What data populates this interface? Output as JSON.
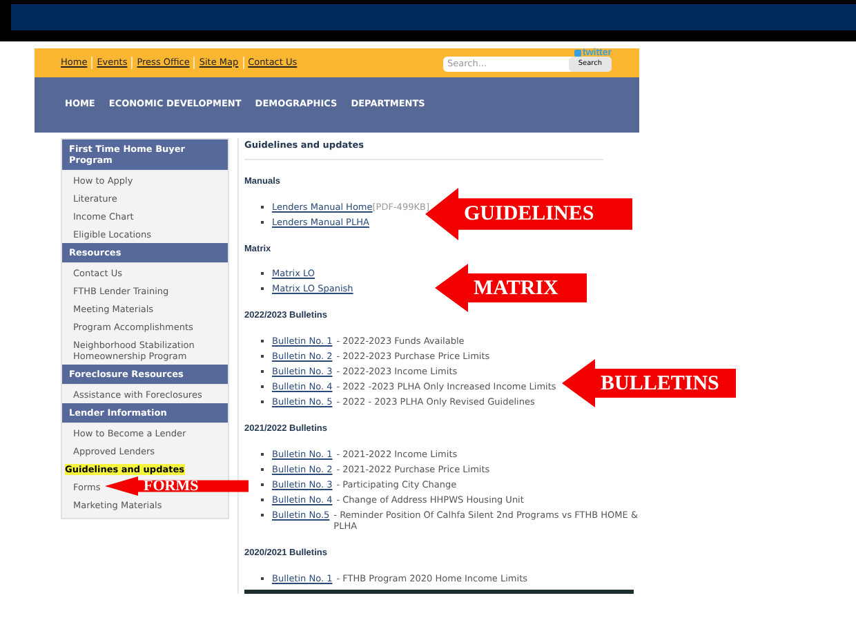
{
  "header": {
    "top_links": [
      "Home",
      "Events",
      "Press Office",
      "Site Map",
      "Contact Us"
    ],
    "twitter": "twitter",
    "search": {
      "placeholder": "Search...",
      "button": "Search"
    }
  },
  "nav": [
    "HOME",
    "ECONOMIC DEVELOPMENT",
    "DEMOGRAPHICS",
    "DEPARTMENTS"
  ],
  "sidebar": [
    {
      "title": "First Time Home Buyer Program",
      "items": [
        {
          "label": "How to Apply",
          "selected": false
        },
        {
          "label": "Literature",
          "selected": false
        },
        {
          "label": "Income Chart",
          "selected": false
        },
        {
          "label": "Eligible Locations",
          "selected": false
        }
      ]
    },
    {
      "title": "Resources",
      "items": [
        {
          "label": "Contact Us",
          "selected": false
        },
        {
          "label": "FTHB Lender Training",
          "selected": false
        },
        {
          "label": "Meeting Materials",
          "selected": false
        },
        {
          "label": "Program Accomplishments",
          "selected": false
        },
        {
          "label": "Neighborhood Stabilization Homeownership Program",
          "selected": false
        }
      ]
    },
    {
      "title": "Foreclosure Resources",
      "items": [
        {
          "label": "Assistance with Foreclosures",
          "selected": false
        }
      ]
    },
    {
      "title": "Lender Information",
      "items": [
        {
          "label": "How to Become a Lender",
          "selected": false
        },
        {
          "label": "Approved Lenders",
          "selected": false
        },
        {
          "label": "Guidelines and updates",
          "selected": true
        },
        {
          "label": "Forms",
          "selected": false
        },
        {
          "label": "Marketing Materials",
          "selected": false
        }
      ]
    }
  ],
  "content": {
    "title": "Guidelines and updates",
    "sections": [
      {
        "heading": "Manuals",
        "items": [
          {
            "link": "Lenders Manual Home",
            "note": "[PDF-499KB]"
          },
          {
            "link": "Lenders Manual PLHA"
          }
        ]
      },
      {
        "heading": "Matrix",
        "items": [
          {
            "link": "Matrix LO"
          },
          {
            "link": "Matrix LO Spanish"
          }
        ]
      },
      {
        "heading": "2022/2023 Bulletins",
        "items": [
          {
            "link": "Bulletin No. 1",
            "text": "-  2022-2023 Funds Available"
          },
          {
            "link": "Bulletin No. 2",
            "text": "-  2022-2023 Purchase Price Limits"
          },
          {
            "link": "Bulletin No. 3",
            "text": "- 2022-2023 Income Limits"
          },
          {
            "link": "Bulletin No. 4",
            "text": "- 2022 -2023 PLHA Only Increased Income Limits"
          },
          {
            "link": "Bulletin No. 5",
            "text": "- 2022 - 2023 PLHA Only Revised Guidelines"
          }
        ]
      },
      {
        "heading": "2021/2022 Bulletins",
        "items": [
          {
            "link": "Bulletin No. 1",
            "text": "-  2021-2022 Income Limits"
          },
          {
            "link": "Bulletin No. 2",
            "text": "-  2021-2022 Purchase Price Limits"
          },
          {
            "link": "Bulletin No. 3",
            "text": "- Participating City Change"
          },
          {
            "link": "Bulletin No. 4",
            "text": "- Change of Address HHPWS Housing Unit"
          },
          {
            "link": "Bulletin No.5",
            "text": "- Reminder Position Of Calhfa Silent 2nd Programs vs FTHB HOME & PLHA"
          }
        ]
      },
      {
        "heading": "2020/2021 Bulletins",
        "items": [
          {
            "link": "Bulletin No. 1",
            "text": "-  FTHB Program 2020 Home Income Limits"
          }
        ]
      }
    ]
  },
  "callouts": [
    {
      "label": "GUIDELINES"
    },
    {
      "label": "MATRIX"
    },
    {
      "label": "BULLETINS"
    },
    {
      "label": "FORMS"
    }
  ]
}
